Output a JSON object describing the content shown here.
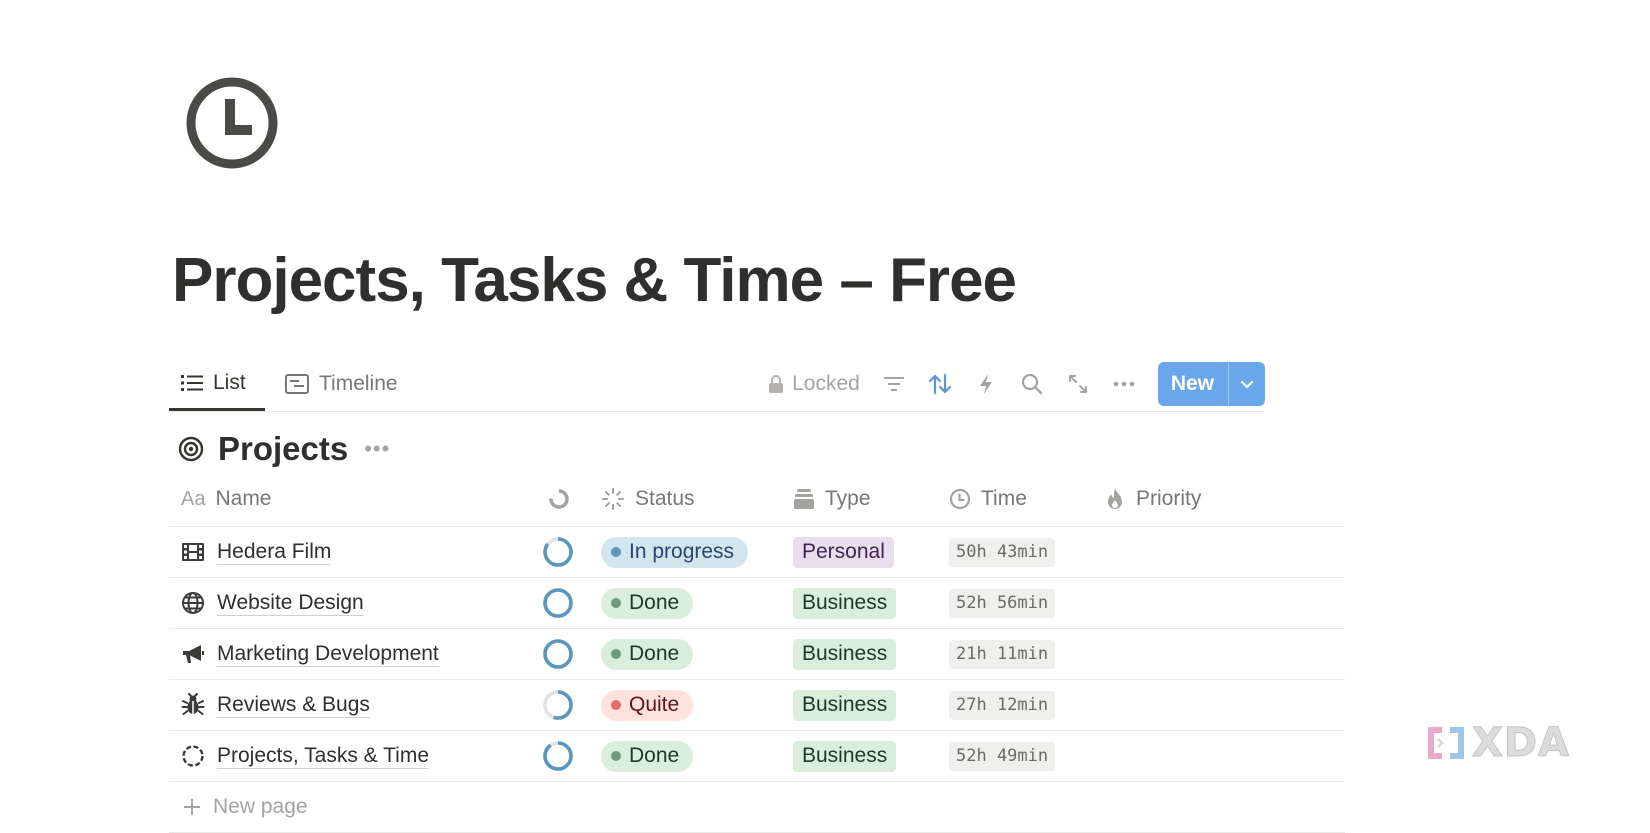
{
  "page": {
    "icon": "clock-icon",
    "title": "Projects, Tasks & Time – Free"
  },
  "views": {
    "tabs": [
      {
        "label": "List",
        "icon": "list-icon",
        "active": true
      },
      {
        "label": "Timeline",
        "icon": "timeline-icon",
        "active": false
      }
    ],
    "locked_label": "Locked",
    "new_label": "New"
  },
  "group": {
    "title": "Projects",
    "icon": "target-icon"
  },
  "columns": [
    {
      "label": "Name",
      "icon": "text-aa-icon"
    },
    {
      "label": "",
      "icon": "rollup-progress-icon"
    },
    {
      "label": "Status",
      "icon": "status-icon"
    },
    {
      "label": "Type",
      "icon": "select-icon"
    },
    {
      "label": "Time",
      "icon": "clock-icon"
    },
    {
      "label": "Priority",
      "icon": "fire-icon"
    }
  ],
  "colors": {
    "accent": "#6aa7ea",
    "status_in_progress_bg": "#d3e5ef",
    "status_in_progress_dot": "#5b97bd",
    "status_done_bg": "#dbeddb",
    "status_done_dot": "#6c9b7d",
    "status_quite_bg": "#ffe2dd",
    "status_quite_dot": "#e16f64",
    "type_personal_bg": "#e8deee",
    "type_business_bg": "#dbeddb",
    "progress_ring": "#5b97bd"
  },
  "rows": [
    {
      "name": "Hedera Film",
      "icon": "film-icon",
      "progress": 0.85,
      "status": "In progress",
      "status_key": "in_progress",
      "type": "Personal",
      "type_key": "personal",
      "time": "50h 43min"
    },
    {
      "name": "Website Design",
      "icon": "globe-icon",
      "progress": 1.0,
      "status": "Done",
      "status_key": "done",
      "type": "Business",
      "type_key": "business",
      "time": "52h 56min"
    },
    {
      "name": "Marketing Development",
      "icon": "megaphone-icon",
      "progress": 1.0,
      "status": "Done",
      "status_key": "done",
      "type": "Business",
      "type_key": "business",
      "time": "21h 11min"
    },
    {
      "name": "Reviews & Bugs",
      "icon": "bug-icon",
      "progress": 0.55,
      "status": "Quite",
      "status_key": "quite",
      "type": "Business",
      "type_key": "business",
      "time": "27h 12min"
    },
    {
      "name": "Projects, Tasks & Time",
      "icon": "dashed-circle-icon",
      "progress": 0.9,
      "status": "Done",
      "status_key": "done",
      "type": "Business",
      "type_key": "business",
      "time": "52h 49min"
    }
  ],
  "new_page_label": "New page",
  "watermark": "XDA"
}
